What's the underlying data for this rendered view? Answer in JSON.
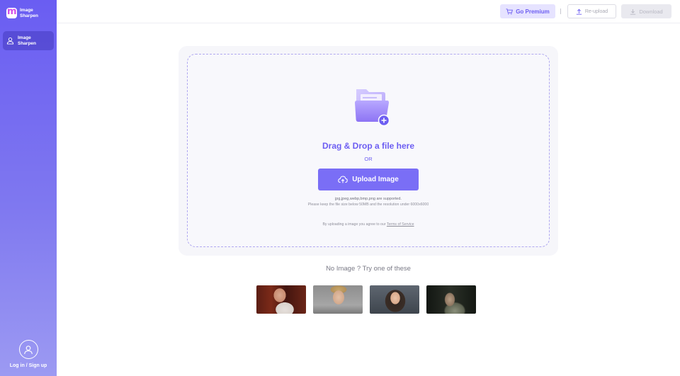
{
  "app": {
    "name": "Image Sharpen",
    "logo_glyph": "m",
    "accent": "#6d5ef2"
  },
  "sidebar": {
    "items": [
      {
        "label": "Image Sharpen",
        "icon": "user-icon",
        "active": true
      }
    ],
    "login_label": "Log in / Sign up"
  },
  "header": {
    "premium_label": "Go Premium",
    "reupload_label": "Re-upload",
    "download_label": "Download"
  },
  "upload": {
    "drop_title": "Drag & Drop a file here",
    "or_label": "OR",
    "button_label": "Upload Image",
    "formats_text": "jpg,jpeg,webp,bmp,png are supported.",
    "limits_text": "Please keep the file size below 50MB and the resolution under 6000x6000",
    "agree_prefix": "By uploading a image you agree to our ",
    "terms_label": "Terms of Service"
  },
  "samples": {
    "title": "No Image ? Try one of these"
  }
}
